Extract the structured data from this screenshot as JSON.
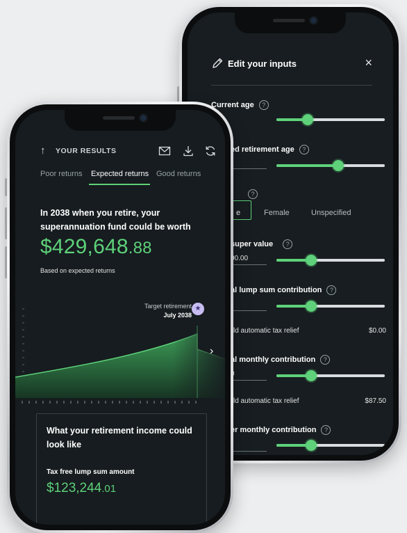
{
  "inputs_panel": {
    "title": "Edit your inputs",
    "close_symbol": "×",
    "help_symbol": "?",
    "current_age_label": "Current age",
    "retirement_age_label": "ed retirement age",
    "gender_options": [
      "e",
      "Female",
      "Unspecified"
    ],
    "super_value_label": "super value",
    "super_value": "00.00",
    "lump_sum_label": "al lump sum contribution",
    "lump_relief_label": "ld automatic tax relief",
    "lump_relief_value": "$0.00",
    "monthly_label": "al monthly contribution",
    "monthly_value": "0",
    "monthly_relief_label": "ld automatic tax relief",
    "monthly_relief_value": "$87.50",
    "employer_label": "er monthly contribution",
    "slider_levels": {
      "current_age": 0.29,
      "retirement_age": 0.57,
      "super_value": 0.32,
      "lump_sum": 0.32,
      "monthly": 0.32,
      "employer": 0.32
    }
  },
  "results": {
    "header_title": "YOUR RESULTS",
    "tabs": [
      "Poor returns",
      "Expected returns",
      "Good returns"
    ],
    "active_tab": 1,
    "headline": "In 2038 when you retire, your superannuation fund could be worth",
    "amount_main": "$429,648",
    "amount_cents": ".88",
    "amount_caption": "Based on expected returns",
    "target_label": "Target retirement",
    "target_date": "July 2038",
    "income_card": {
      "title": "What your retirement income could look like",
      "lump_label": "Tax free lump sum amount",
      "lump_main": "$123,244",
      "lump_cents": ".01"
    }
  },
  "colors": {
    "accent": "#5ed17a",
    "screen_bg": "#161c1f",
    "badge": "#c7bdf2"
  }
}
